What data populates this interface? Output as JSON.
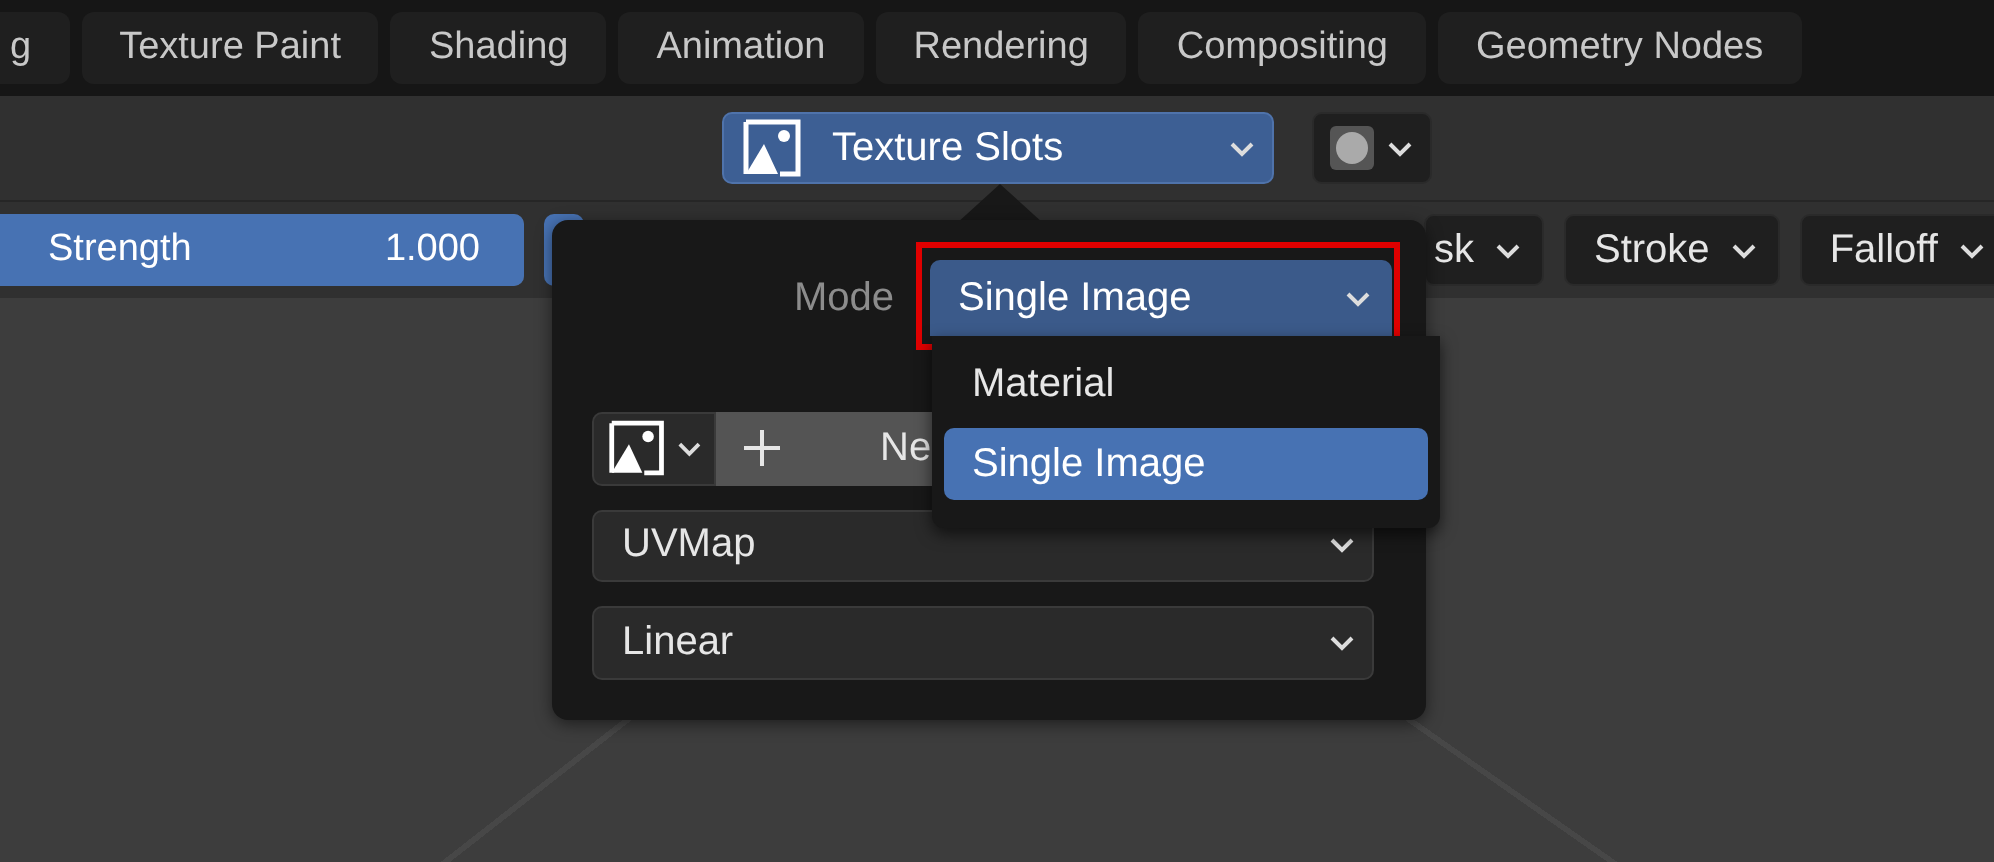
{
  "workspace_tabs": [
    {
      "label": "g"
    },
    {
      "label": "Texture Paint"
    },
    {
      "label": "Shading"
    },
    {
      "label": "Animation"
    },
    {
      "label": "Rendering"
    },
    {
      "label": "Compositing"
    },
    {
      "label": "Geometry Nodes"
    }
  ],
  "header": {
    "slot_dropdown": "Texture Slots"
  },
  "tool_settings": {
    "strength": {
      "label": "Strength",
      "value": "1.000",
      "level": 1
    },
    "dropdowns": [
      "sk",
      "Stroke",
      "Falloff"
    ]
  },
  "popover": {
    "mode_label": "Mode",
    "mode_value": "Single Image",
    "highlighted": true,
    "menu": [
      {
        "label": "Material",
        "selected": false
      },
      {
        "label": "Single Image",
        "selected": true
      }
    ],
    "new_button": "Ne",
    "uv_map": "UVMap",
    "interpolation": "Linear"
  }
}
